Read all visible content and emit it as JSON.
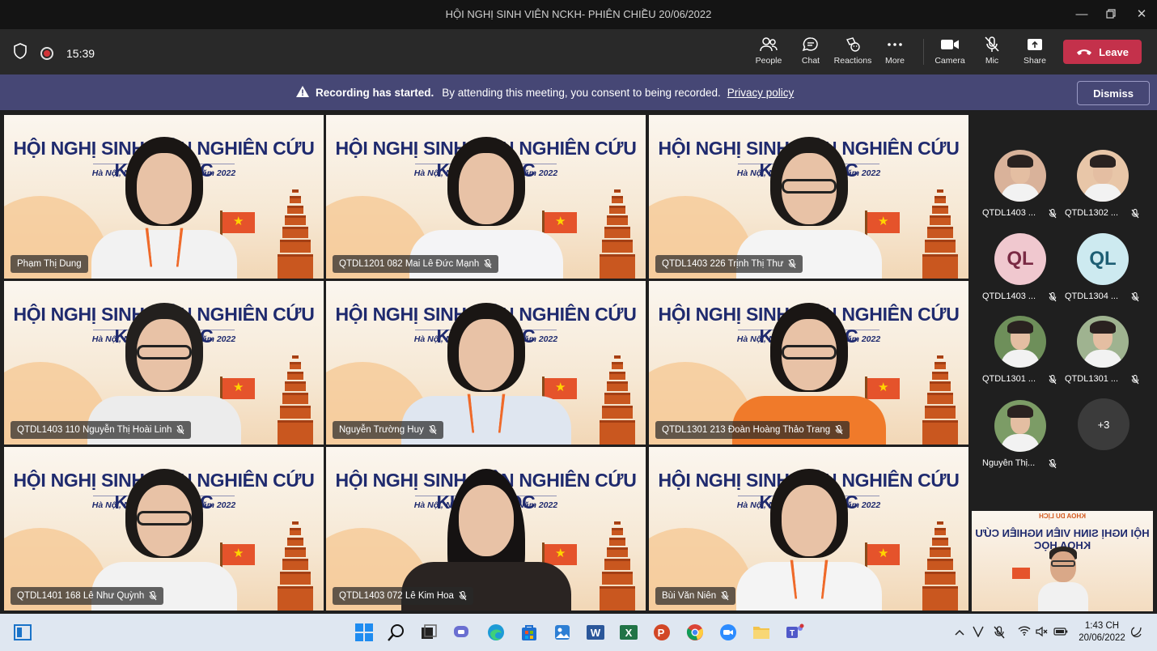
{
  "window": {
    "title": "HỘI NGHỊ SINH VIÊN NCKH- PHIÊN CHIỀU 20/06/2022"
  },
  "toolbar": {
    "timer": "15:39",
    "buttons": [
      {
        "label": "People",
        "icon": "people-icon"
      },
      {
        "label": "Chat",
        "icon": "chat-icon"
      },
      {
        "label": "Reactions",
        "icon": "reactions-icon"
      },
      {
        "label": "More",
        "icon": "more-icon"
      },
      {
        "label": "Camera",
        "icon": "camera-icon"
      },
      {
        "label": "Mic",
        "icon": "mic-off-icon"
      },
      {
        "label": "Share",
        "icon": "share-icon"
      }
    ],
    "leave_label": "Leave",
    "leave_color": "#c4314b"
  },
  "banner": {
    "title": "Recording has started.",
    "message": "By attending this meeting, you consent to being recorded.",
    "link": "Privacy policy",
    "dismiss_label": "Dismiss",
    "color": "#464775"
  },
  "slide": {
    "heading": "HỘI NGHỊ SINH VIÊN NGHIÊN CỨU KHOA HỌC",
    "date_line": "Hà Nội, Ngày 20 tháng 06 Năm 2022",
    "faculty": "KHOA DU LỊCH"
  },
  "tiles": [
    {
      "name": "Phạm Thị Dung",
      "muted": false
    },
    {
      "name": "QTDL1201 082 Mai Lê Đức Mạnh",
      "muted": true
    },
    {
      "name": "QTDL1403 226 Trịnh Thị Thư",
      "muted": true
    },
    {
      "name": "QTDL1403 110 Nguyễn Thị Hoài Linh",
      "muted": true
    },
    {
      "name": "Nguyễn Trường Huy",
      "muted": true
    },
    {
      "name": "QTDL1301 213 Đoàn Hoàng Thảo Trang",
      "muted": true
    },
    {
      "name": "QTDL1401 168 Lê Như Quỳnh",
      "muted": true
    },
    {
      "name": "QTDL1403 072 Lê Kim Hoa",
      "muted": true
    },
    {
      "name": "Bùi Văn Niên",
      "muted": true
    }
  ],
  "participants": [
    {
      "name": "QTDL1403 ...",
      "initials": ""
    },
    {
      "name": "QTDL1302 ...",
      "initials": ""
    },
    {
      "name": "QTDL1403 ...",
      "initials": "QL"
    },
    {
      "name": "QTDL1304 ...",
      "initials": "QL"
    },
    {
      "name": "QTDL1301 ...",
      "initials": ""
    },
    {
      "name": "QTDL1301 ...",
      "initials": ""
    },
    {
      "name": "Nguyễn Thị...",
      "initials": ""
    }
  ],
  "more_count": "+3",
  "taskbar": {
    "time": "1:43 CH",
    "date": "20/06/2022"
  }
}
